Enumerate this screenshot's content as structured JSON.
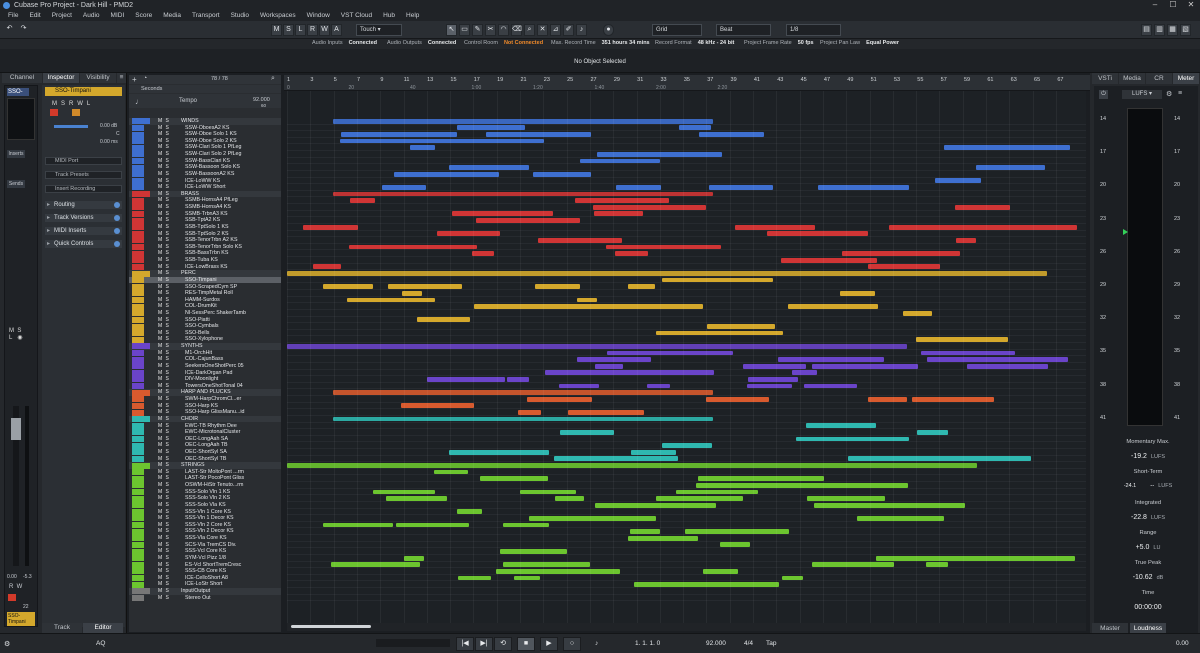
{
  "window": {
    "title": "Cubase Pro Project - Dark Hill - PMD2"
  },
  "menu": [
    "File",
    "Edit",
    "Project",
    "Audio",
    "MIDI",
    "Score",
    "Media",
    "Transport",
    "Studio",
    "Workspaces",
    "Window",
    "VST Cloud",
    "Hub",
    "Help"
  ],
  "toolbar": {
    "mode_buttons": [
      "M",
      "S",
      "L",
      "R",
      "W",
      "A"
    ],
    "automation_mode": "Touch",
    "grid_type": "Grid",
    "grid_base": "Beat",
    "quantize": "1/8"
  },
  "status": [
    {
      "label": "Audio Inputs",
      "value": "Connected"
    },
    {
      "label": "Audio Outputs",
      "value": "Connected"
    },
    {
      "label": "Control Room",
      "value": "Not Connected"
    },
    {
      "label": "Max. Record Time",
      "value": "351 hours 34 mins"
    },
    {
      "label": "Record Format",
      "value": "48 kHz - 24 bit"
    },
    {
      "label": "Project Frame Rate",
      "value": "50 fps"
    },
    {
      "label": "Project Pan Law",
      "value": "Equal Power"
    }
  ],
  "info_line": "No Object Selected",
  "left_tabs": [
    "Channel",
    "Inspector",
    "Visibility"
  ],
  "bottom_tabs": [
    "Track",
    "Editor"
  ],
  "channel": {
    "name": "SSO-",
    "sends_label": "Inserts",
    "sends2": "Sends",
    "value1": "0.00",
    "value2": "-5.3",
    "value3": "22",
    "bottom_name": "SSO-Timpani"
  },
  "inspector": {
    "track_name": "SSO-Timpani",
    "vol": "0.00 dB",
    "pan": "C",
    "delay": "0.00 ms",
    "midi_port": "MIDI Port",
    "presets": "Track Presets",
    "insert_rec": "Insert Recording",
    "sections": [
      "Routing",
      "Track Versions",
      "MIDI Inserts",
      "Quick Controls"
    ]
  },
  "tracklist": {
    "counter": "78 / 78",
    "ruler_track": "Seconds",
    "tempo_label": "Tempo",
    "tempo_value": "92.000",
    "sig_value": "60"
  },
  "tracks": [
    {
      "n": "WINDS",
      "c": "#3e6fd0",
      "f": true
    },
    {
      "n": "SSW-OboesA2 KS",
      "c": "#3e6fd0"
    },
    {
      "n": "SSW-Oboe Solo 1 KS",
      "c": "#3e6fd0"
    },
    {
      "n": "SSW-Oboe Solo 2 KS",
      "c": "#3e6fd0"
    },
    {
      "n": "SSW-Clari Solo 1 PfLeg",
      "c": "#3e6fd0"
    },
    {
      "n": "SSW-Clari Solo 2 PfLeg",
      "c": "#3e6fd0"
    },
    {
      "n": "SSW-BassClari KS",
      "c": "#3e6fd0"
    },
    {
      "n": "SSW-Bassoon Solo KS",
      "c": "#3e6fd0"
    },
    {
      "n": "SSW-BassoonA2 KS",
      "c": "#3e6fd0"
    },
    {
      "n": "ICE-LoWW KS",
      "c": "#3e6fd0"
    },
    {
      "n": "ICE-LoWW Short",
      "c": "#3e6fd0"
    },
    {
      "n": "BRASS",
      "c": "#d03535",
      "f": true
    },
    {
      "n": "SSMB-HornsA4 PfLeg",
      "c": "#d03535"
    },
    {
      "n": "SSMB-HornsA4 KS",
      "c": "#d03535"
    },
    {
      "n": "SSMB-TrbnA3 KS",
      "c": "#d03535"
    },
    {
      "n": "SSB-TptA2 KS",
      "c": "#d03535"
    },
    {
      "n": "SSB-TptSolo 1 KS",
      "c": "#d03535"
    },
    {
      "n": "SSB-TptSolo 2 KS",
      "c": "#d03535"
    },
    {
      "n": "SSB-TenorTrbn A2 KS",
      "c": "#d03535"
    },
    {
      "n": "SSB-TenorTrbn Solo KS",
      "c": "#d03535"
    },
    {
      "n": "SSB-BassTrbn KS",
      "c": "#d03535"
    },
    {
      "n": "SSB-Tuba KS",
      "c": "#d03535"
    },
    {
      "n": "ICE-LowBrass KS",
      "c": "#d03535"
    },
    {
      "n": "PERC",
      "c": "#d4a82c",
      "f": true
    },
    {
      "n": "SSO-Timpani",
      "c": "#d4a82c",
      "sel": true
    },
    {
      "n": "SSO-ScrapedCym SP",
      "c": "#d4a82c"
    },
    {
      "n": "RES-TimpMetal Roll",
      "c": "#d4a82c"
    },
    {
      "n": "HAMM-Surdos",
      "c": "#d4a82c"
    },
    {
      "n": "COL-DrumKit",
      "c": "#d4a82c"
    },
    {
      "n": "NI-SessPerc ShakerTamb",
      "c": "#d4a82c"
    },
    {
      "n": "SSO-Piatti",
      "c": "#d4a82c"
    },
    {
      "n": "SSO-Cymbals",
      "c": "#d4a82c"
    },
    {
      "n": "SSO-Bells",
      "c": "#d4a82c"
    },
    {
      "n": "SSO-Xylophone",
      "c": "#d4a82c"
    },
    {
      "n": "SYNTHS",
      "c": "#6a44c9",
      "f": true
    },
    {
      "n": "M1-OrchHit",
      "c": "#6a44c9"
    },
    {
      "n": "COL-CajunBass",
      "c": "#6a44c9"
    },
    {
      "n": "SeekersOneShotPerc 05",
      "c": "#6a44c9"
    },
    {
      "n": "ICE-DarkOrgan Pad",
      "c": "#6a44c9"
    },
    {
      "n": "DIV-Moonlight",
      "c": "#6a44c9"
    },
    {
      "n": "TowersOneShotTonal 04",
      "c": "#6a44c9"
    },
    {
      "n": "HARP AND PLUCKS",
      "c": "#d85a2e",
      "f": true
    },
    {
      "n": "SWM-HarpChromCl...er",
      "c": "#d85a2e"
    },
    {
      "n": "SSO-Harp KS",
      "c": "#d85a2e"
    },
    {
      "n": "SSO-Harp GlissManu...id",
      "c": "#d85a2e"
    },
    {
      "n": "CHOIR",
      "c": "#2fb8b0",
      "f": true
    },
    {
      "n": "EWC-TB Rhythm Dee",
      "c": "#2fb8b0"
    },
    {
      "n": "EWC-MicrotonalCluster",
      "c": "#2fb8b0"
    },
    {
      "n": "OEC-LongAah SA",
      "c": "#2fb8b0"
    },
    {
      "n": "OEC-LongAah TB",
      "c": "#2fb8b0"
    },
    {
      "n": "OEC-ShortSyl SA",
      "c": "#2fb8b0"
    },
    {
      "n": "OEC-ShortSyl TB",
      "c": "#2fb8b0"
    },
    {
      "n": "STRINGS",
      "c": "#6cc52f",
      "f": true
    },
    {
      "n": "LAST-Str MoltoPont ...rm",
      "c": "#6cc52f"
    },
    {
      "n": "LAST-Str PocoPont Gliss",
      "c": "#6cc52f"
    },
    {
      "n": "OSWM-HiStr Tenuto...rm",
      "c": "#6cc52f"
    },
    {
      "n": "SSS-Solo Vln 1 KS",
      "c": "#6cc52f"
    },
    {
      "n": "SSS-Solo Vln 2 KS",
      "c": "#6cc52f"
    },
    {
      "n": "SSS-Solo Vla KS",
      "c": "#6cc52f"
    },
    {
      "n": "SSS-Vln 1 Core KS",
      "c": "#6cc52f"
    },
    {
      "n": "SSS-Vln 1 Decor KS",
      "c": "#6cc52f"
    },
    {
      "n": "SSS-Vln 2 Core KS",
      "c": "#6cc52f"
    },
    {
      "n": "SSS-Vln 2 Decor KS",
      "c": "#6cc52f"
    },
    {
      "n": "SSS-Vla Core KS",
      "c": "#6cc52f"
    },
    {
      "n": "SCS-Vla TremCS Div.",
      "c": "#6cc52f"
    },
    {
      "n": "SSS-Vcl Core KS",
      "c": "#6cc52f"
    },
    {
      "n": "SYM-Vcl Pizz 1/8",
      "c": "#6cc52f"
    },
    {
      "n": "ES-Vcl ShortTremCresc",
      "c": "#6cc52f"
    },
    {
      "n": "SSS-CB Core KS",
      "c": "#6cc52f"
    },
    {
      "n": "ICE-CelloShort A8",
      "c": "#6cc52f"
    },
    {
      "n": "ICE-LoStr Short",
      "c": "#6cc52f"
    },
    {
      "n": "Input/Output",
      "c": "#777777",
      "f": true
    },
    {
      "n": "Stereo Out",
      "c": "#777777"
    }
  ],
  "ruler": {
    "bars": [
      "1",
      "3",
      "5",
      "7",
      "9",
      "11",
      "13",
      "15",
      "17",
      "19",
      "21",
      "23",
      "25",
      "27",
      "29",
      "31",
      "33",
      "35",
      "37",
      "39",
      "41",
      "43",
      "45",
      "47",
      "49",
      "51",
      "53",
      "55",
      "57",
      "59",
      "61",
      "63",
      "65",
      "67"
    ],
    "times": [
      "0",
      "20",
      "40",
      "1:00",
      "1:20",
      "1:40",
      "2:00",
      "2:20"
    ]
  },
  "right_tabs": [
    "VSTi",
    "Media",
    "CR",
    "Meter"
  ],
  "meter": {
    "mode": "LUFS",
    "scale": [
      "14",
      "17",
      "20",
      "23",
      "26",
      "29",
      "32",
      "35",
      "38",
      "41"
    ],
    "momentary_label": "Momentary Max.",
    "momentary": "-19.2",
    "unit": "LUFS",
    "short_label": "Short-Term",
    "short_min": "-24.1",
    "short": "--",
    "integrated_label": "Integrated",
    "integrated": "-22.8",
    "range_label": "Range",
    "range": "+5.0",
    "range_unit": "LU",
    "truepeak_label": "True Peak",
    "truepeak": "-10.62",
    "truepeak_unit": "dB",
    "time_label": "Time",
    "time": "00:00:00",
    "bottom_tabs": [
      "Master",
      "Loudness"
    ]
  },
  "transport": {
    "position": "1. 1. 1. 0",
    "tempo": "92.000",
    "signature": "4/4",
    "tap": "Tap",
    "aq": "AQ",
    "right_time": "0.00"
  }
}
